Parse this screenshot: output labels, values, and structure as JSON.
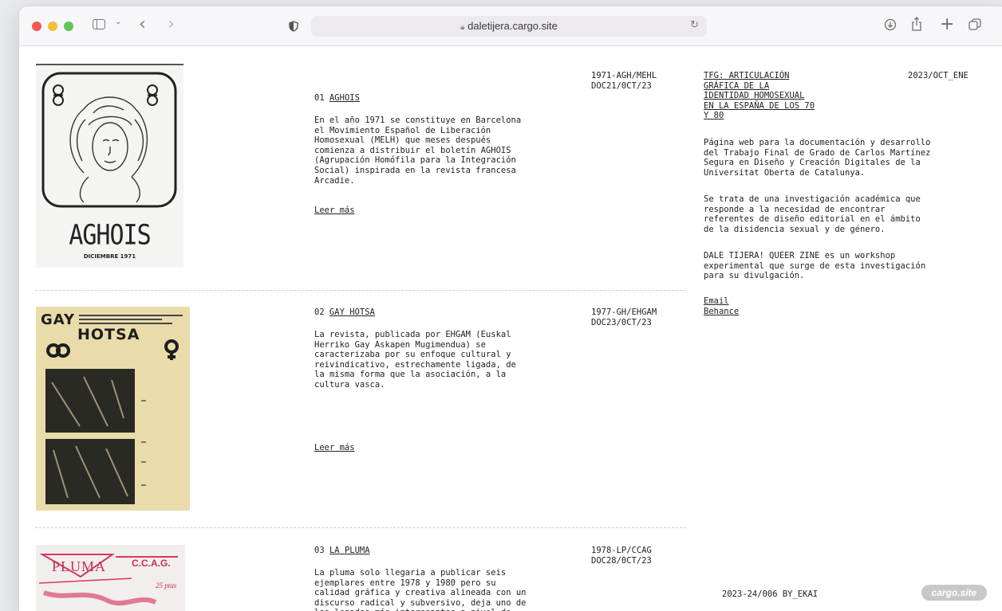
{
  "browser": {
    "url": "daletijera.cargo.site",
    "colors": {
      "close": "#ee5b53",
      "minimize": "#f5bd3e",
      "zoom": "#60c554"
    },
    "icons": [
      "shield-icon",
      "lock-icon",
      "reload-icon",
      "download-icon",
      "share-icon",
      "new-tab-icon",
      "tabs-overview-icon"
    ]
  },
  "items": [
    {
      "title_number": "01",
      "title": "AGHOIS",
      "code": "1971-AGH/MEHL",
      "doc": "DOC21/0CT/23",
      "description": "En el año 1971 se constituye en Barcelona\nel Movimiento Español de Liberación\nHomosexual (MELH) que meses después\ncomienza a distribuir el boletín AGHOIS\n(Agrupación Homófila para la Integración\nSocial) inspirada en la revista francesa\nArcadie.",
      "read_more": "Leer más",
      "cover_title": "AGHOIS",
      "cover_subtitle": "DICIEMBRE 1971"
    },
    {
      "title_number": "02",
      "title": "GAY HOTSA",
      "code": "1977-GH/EHGAM",
      "doc": "DOC23/0CT/23",
      "description": "La revista, publicada por EHGAM (Euskal\nHerriko Gay Askapen Mugimendua) se\ncaracterizaba por su enfoque cultural y\nreivindicativo, estrechamente ligada, de\nla misma forma que la asociación, a la\ncultura vasca.",
      "read_more": "Leer más",
      "cover_title_1": "GAY",
      "cover_title_2": "HOTSA"
    },
    {
      "title_number": "03",
      "title": "LA PLUMA",
      "code": "1978-LP/CCAG",
      "doc": "DOC28/0CT/23",
      "description": "La pluma solo llegaria a publicar seis\nejemplares entre 1978 y 1980 pero su\ncalidad gráfica y creativa alineada con un\ndiscurso radical y subversivo, deja uno de\nlos legados más interesantes a nivel de",
      "cover_title": "PLUMA",
      "cover_org": "C.C.A.G.",
      "cover_price": "25 ptas"
    }
  ],
  "sidebar": {
    "title": "TFG: ARTICULACIÓN\nGRÁFICA DE LA\nIDENTIDAD HOMOSEXUAL\nEN LA ESPAÑA DE LOS 70\nY 80",
    "date": "2023/OCT_ENE",
    "paragraph_1": "Página web para la documentación y desarrollo\ndel Trabajo Final de Grado de Carlos Martínez\nSegura en Diseño y Creación Digitales de la\nUniversitat Oberta de Catalunya.",
    "paragraph_2": "Se trata de una investigación académica que\nresponde a la necesidad de encontrar\nreferentes de diseño editorial en el ámbito\nde la disidencia sexual y de género.",
    "paragraph_3": "DALE TIJERA! QUEER ZINE es un workshop\nexperimental que surge de esta investigación\npara su divulgación.",
    "link_email": "Email",
    "link_behance": "Behance"
  },
  "footer": {
    "credit": "2023-24/006 BY_EKAI",
    "badge": "cargo.site"
  }
}
